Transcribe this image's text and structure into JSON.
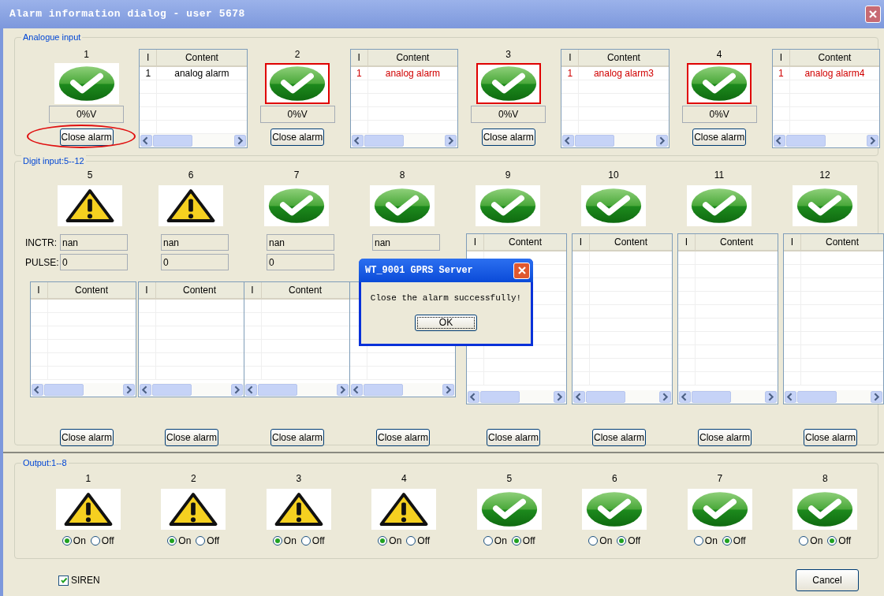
{
  "window": {
    "title": "Alarm information dialog - user 5678"
  },
  "analogue": {
    "title": "Analogue input",
    "channels": [
      {
        "label": "1",
        "warning": false,
        "alarm": false,
        "value": "0%V",
        "button": "Close alarm",
        "circled": true,
        "table": {
          "columns": [
            "I",
            "Content"
          ],
          "rows": [
            {
              "cells": [
                "1",
                "analog alarm"
              ],
              "alarm": false
            }
          ]
        }
      },
      {
        "label": "2",
        "warning": false,
        "alarm": true,
        "value": "0%V",
        "button": "Close alarm",
        "circled": false,
        "table": {
          "columns": [
            "I",
            "Content"
          ],
          "rows": [
            {
              "cells": [
                "1",
                "analog alarm"
              ],
              "alarm": true
            }
          ]
        }
      },
      {
        "label": "3",
        "warning": false,
        "alarm": true,
        "value": "0%V",
        "button": "Close alarm",
        "circled": false,
        "table": {
          "columns": [
            "I",
            "Content"
          ],
          "rows": [
            {
              "cells": [
                "1",
                "analog alarm3"
              ],
              "alarm": true
            }
          ]
        }
      },
      {
        "label": "4",
        "warning": false,
        "alarm": true,
        "value": "0%V",
        "button": "Close alarm",
        "circled": false,
        "table": {
          "columns": [
            "I",
            "Content"
          ],
          "rows": [
            {
              "cells": [
                "1",
                "analog alarm4"
              ],
              "alarm": true
            }
          ]
        }
      }
    ]
  },
  "digit": {
    "title": "Digit input:5--12",
    "channels": [
      {
        "label": "5",
        "warning": true,
        "kind": "counter",
        "fields": [
          {
            "label": "INCTR:",
            "value": "nan"
          },
          {
            "label": "PULSE:",
            "value": "0"
          }
        ],
        "table": {
          "columns": [
            "I",
            "Content"
          ]
        },
        "button": "Close alarm"
      },
      {
        "label": "6",
        "warning": true,
        "kind": "counter",
        "fields": [
          {
            "value": "nan"
          },
          {
            "value": "0"
          }
        ],
        "table": {
          "columns": [
            "I",
            "Content"
          ]
        },
        "button": "Close alarm"
      },
      {
        "label": "7",
        "warning": false,
        "kind": "counter",
        "fields": [
          {
            "value": "nan"
          },
          {
            "value": "0"
          }
        ],
        "table": {
          "columns": [
            "I",
            "Content"
          ]
        },
        "button": "Close alarm"
      },
      {
        "label": "8",
        "warning": false,
        "kind": "counter",
        "fields": [
          {
            "value": "nan"
          }
        ],
        "button": "Close alarm"
      },
      {
        "label": "9",
        "warning": false,
        "kind": "list",
        "table": {
          "columns": [
            "I",
            "Content"
          ]
        },
        "button": "Close alarm"
      },
      {
        "label": "10",
        "warning": false,
        "kind": "list",
        "table": {
          "columns": [
            "I",
            "Content"
          ]
        },
        "button": "Close alarm"
      },
      {
        "label": "11",
        "warning": false,
        "kind": "list",
        "table": {
          "columns": [
            "I",
            "Content"
          ]
        },
        "button": "Close alarm"
      },
      {
        "label": "12",
        "warning": false,
        "kind": "list",
        "table": {
          "columns": [
            "I",
            "Content"
          ]
        },
        "button": "Close alarm"
      }
    ]
  },
  "output": {
    "title": "Output:1--8",
    "channels": [
      {
        "label": "1",
        "warning": true,
        "options": [
          {
            "label": "On",
            "selected": true
          },
          {
            "label": "Off",
            "selected": false
          }
        ]
      },
      {
        "label": "2",
        "warning": true,
        "options": [
          {
            "label": "On",
            "selected": true
          },
          {
            "label": "Off",
            "selected": false
          }
        ]
      },
      {
        "label": "3",
        "warning": true,
        "options": [
          {
            "label": "On",
            "selected": true
          },
          {
            "label": "Off",
            "selected": false
          }
        ]
      },
      {
        "label": "4",
        "warning": true,
        "options": [
          {
            "label": "On",
            "selected": true
          },
          {
            "label": "Off",
            "selected": false
          }
        ]
      },
      {
        "label": "5",
        "warning": false,
        "options": [
          {
            "label": "On",
            "selected": false
          },
          {
            "label": "Off",
            "selected": true
          }
        ]
      },
      {
        "label": "6",
        "warning": false,
        "options": [
          {
            "label": "On",
            "selected": false
          },
          {
            "label": "Off",
            "selected": true
          }
        ]
      },
      {
        "label": "7",
        "warning": false,
        "options": [
          {
            "label": "On",
            "selected": false
          },
          {
            "label": "Off",
            "selected": true
          }
        ]
      },
      {
        "label": "8",
        "warning": false,
        "options": [
          {
            "label": "On",
            "selected": false
          },
          {
            "label": "Off",
            "selected": true
          }
        ]
      }
    ]
  },
  "siren": {
    "label": "SIREN",
    "checked": true
  },
  "cancel_button": "Cancel",
  "message_box": {
    "title": "WT_9001 GPRS Server",
    "message": "Close the alarm successfully!",
    "button": "OK"
  }
}
